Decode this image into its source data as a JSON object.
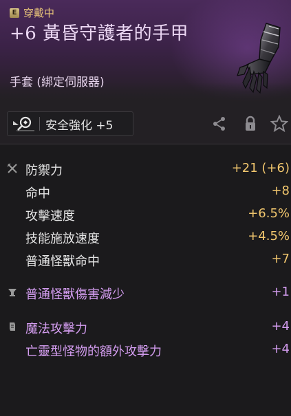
{
  "header": {
    "equip_badge": "E",
    "equip_status": "穿戴中",
    "item_name": "+6 黃昏守護者的手甲",
    "item_type": "手套 (綁定伺服器)"
  },
  "actions": {
    "enhance_label": "安全強化 +5",
    "icons": [
      "magnify-enhance-icon",
      "share-icon",
      "lock-icon",
      "star-icon"
    ]
  },
  "base_stats": [
    {
      "label": "防禦力",
      "value": "+21 (+6)"
    },
    {
      "label": "命中",
      "value": "+8"
    },
    {
      "label": "攻擊速度",
      "value": "+6.5%"
    },
    {
      "label": "技能施放速度",
      "value": "+4.5%"
    },
    {
      "label": "普通怪獸命中",
      "value": "+7"
    }
  ],
  "socket_stat": {
    "label": "普通怪獸傷害減少",
    "value": "+1"
  },
  "magic_stats": [
    {
      "label": "魔法攻擊力",
      "value": "+4"
    },
    {
      "label": "亡靈型怪物的額外攻擊力",
      "value": "+4"
    }
  ],
  "colors": {
    "gold": "#f2c76e",
    "purple": "#d49df0",
    "equip_text": "#eac67a",
    "header_bg": "#3b2247"
  }
}
